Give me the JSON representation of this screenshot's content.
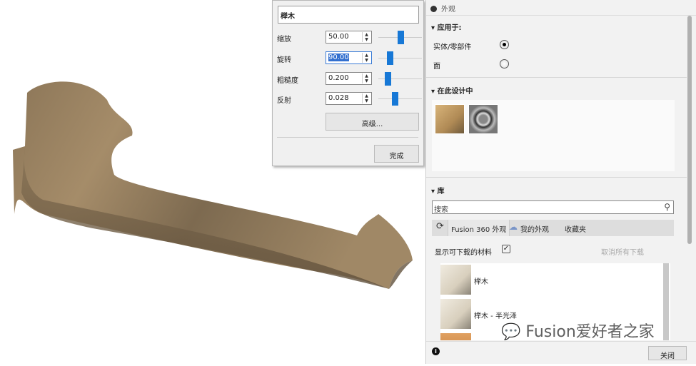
{
  "editor": {
    "name": "榉木",
    "props": [
      {
        "label": "缩放",
        "value": "50.00",
        "slider": 0.5
      },
      {
        "label": "旋转",
        "value": "90.00",
        "slider": 0.27
      },
      {
        "label": "粗糙度",
        "value": "0.200",
        "slider": 0.22
      },
      {
        "label": "反射",
        "value": "0.028",
        "slider": 0.37
      }
    ],
    "advanced": "高级...",
    "done": "完成"
  },
  "panel": {
    "title": "外观",
    "apply_to": "应用于:",
    "opt_body": "实体/零部件",
    "opt_face": "面",
    "in_design": "在此设计中",
    "library": "库",
    "search_placeholder": "搜索",
    "tabs": [
      "Fusion 360 外观",
      "我的外观",
      "收藏夹"
    ],
    "show_downloadable": "显示可下载的材料",
    "cancel_downloads": "取消所有下载",
    "items": [
      "榉木",
      "榉木 - 半光泽"
    ],
    "close": "关闭",
    "watermark": "Fusion爱好者之家"
  }
}
